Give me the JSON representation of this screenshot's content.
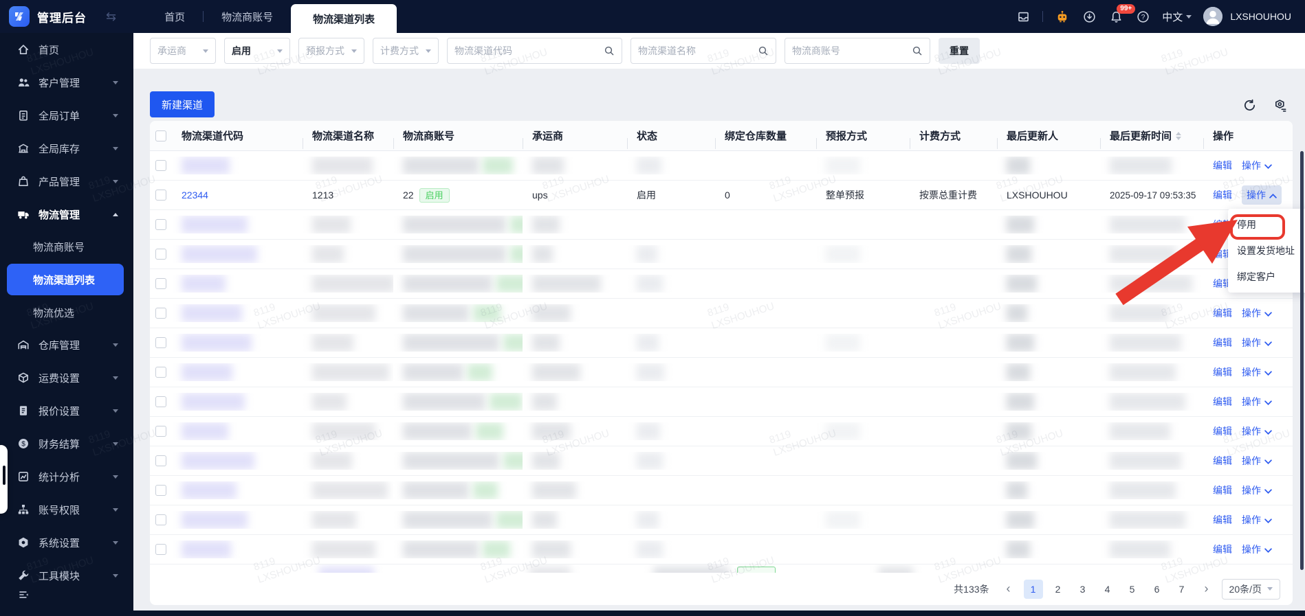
{
  "colors": {
    "accent": "#1f57f0",
    "link": "#2e5bf0",
    "status_green": "#47cf5e",
    "annotation_red": "#e8392e",
    "topbar_bg": "#0b1631",
    "sidebar_bg": "#0a1429"
  },
  "topbar": {
    "brand": "管理后台",
    "tabs": [
      "首页",
      "物流商账号",
      "物流渠道列表"
    ],
    "active_tab": "物流渠道列表",
    "badge_count": "99+",
    "language": "中文",
    "username": "LXSHOUHOU"
  },
  "sidebar": {
    "items": [
      {
        "label": "首页",
        "icon": "home-icon",
        "chevron": false
      },
      {
        "label": "客户管理",
        "icon": "users-icon",
        "chevron": true
      },
      {
        "label": "全局订单",
        "icon": "order-icon",
        "chevron": true
      },
      {
        "label": "全局库存",
        "icon": "inventory-icon",
        "chevron": true
      },
      {
        "label": "产品管理",
        "icon": "product-icon",
        "chevron": true
      },
      {
        "label": "物流管理",
        "icon": "truck-icon",
        "chevron": true,
        "expanded": true
      },
      {
        "label": "仓库管理",
        "icon": "warehouse-icon",
        "chevron": true
      },
      {
        "label": "运费设置",
        "icon": "freight-icon",
        "chevron": true
      },
      {
        "label": "报价设置",
        "icon": "quote-icon",
        "chevron": true
      },
      {
        "label": "财务结算",
        "icon": "finance-icon",
        "chevron": true
      },
      {
        "label": "统计分析",
        "icon": "stats-icon",
        "chevron": true
      },
      {
        "label": "账号权限",
        "icon": "accounts-icon",
        "chevron": true
      },
      {
        "label": "系统设置",
        "icon": "settings-icon",
        "chevron": true
      },
      {
        "label": "工具模块",
        "icon": "tools-icon",
        "chevron": true
      }
    ],
    "submenu": {
      "parent": "物流管理",
      "children": [
        "物流商账号",
        "物流渠道列表",
        "物流优选"
      ],
      "active": "物流渠道列表"
    }
  },
  "filters": {
    "selects": [
      {
        "label": "承运商",
        "selected": false
      },
      {
        "label": "启用",
        "selected": true
      },
      {
        "label": "预报方式",
        "selected": false
      },
      {
        "label": "计费方式",
        "selected": false
      }
    ],
    "inputs": [
      {
        "placeholder": "物流渠道代码"
      },
      {
        "placeholder": "物流渠道名称"
      },
      {
        "placeholder": "物流商账号"
      }
    ],
    "reset_label": "重置"
  },
  "toolbar": {
    "create_label": "新建渠道"
  },
  "table": {
    "columns": [
      "物流渠道代码",
      "物流渠道名称",
      "物流商账号",
      "承运商",
      "状态",
      "绑定仓库数量",
      "预报方式",
      "计费方式",
      "最后更新人",
      "最后更新时间",
      "操作"
    ],
    "sort_column": "最后更新时间",
    "edit_label": "编辑",
    "action_label": "操作",
    "rows": [
      {
        "redacted": true
      },
      {
        "redacted": false,
        "code": "22344",
        "name": "1213",
        "account": "22",
        "account_badge": "启用",
        "carrier": "ups",
        "status": "启用",
        "warehouses": "0",
        "forecast": "整单预报",
        "billing": "按票总重计费",
        "updater": "LXSHOUHOU",
        "updated": "2025-09-17 09:53:35",
        "action_open": true
      },
      {
        "redacted": true
      },
      {
        "redacted": true
      },
      {
        "redacted": true
      },
      {
        "redacted": true
      },
      {
        "redacted": true
      },
      {
        "redacted": true
      },
      {
        "redacted": true
      },
      {
        "redacted": true
      },
      {
        "redacted": true
      },
      {
        "redacted": true
      },
      {
        "redacted": true
      },
      {
        "redacted": true
      }
    ]
  },
  "action_menu": {
    "items": [
      "停用",
      "设置发货地址",
      "绑定客户"
    ],
    "annotated_item": "停用"
  },
  "pagination": {
    "total": "共133条",
    "pages": [
      "1",
      "2",
      "3",
      "4",
      "5",
      "6",
      "7"
    ],
    "active_page": "1",
    "page_size": "20条/页"
  },
  "watermark": {
    "line1": "8119",
    "line2": "LXSHOUHOU"
  }
}
